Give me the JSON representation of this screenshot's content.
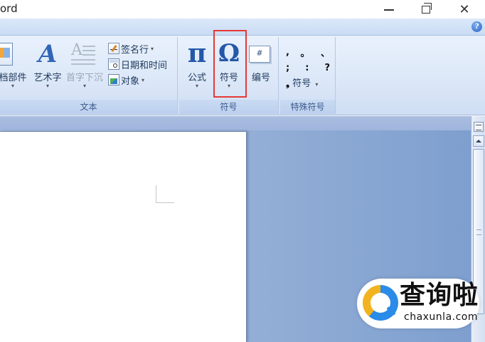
{
  "window": {
    "title": "ord",
    "minimize": "minimize",
    "maximize": "restore",
    "close": "close"
  },
  "ribbon": {
    "groups": {
      "text": {
        "label": "文本",
        "big_buttons": [
          {
            "label": "档部件",
            "icon": "quick-parts-icon"
          },
          {
            "label": "艺术字",
            "icon": "wordart-icon"
          },
          {
            "label": "首字下沉",
            "icon": "drop-cap-icon",
            "disabled": true
          }
        ],
        "small_buttons": [
          {
            "label": "签名行",
            "icon": "signature-line-icon",
            "has_dropdown": true
          },
          {
            "label": "日期和时间",
            "icon": "date-time-icon",
            "has_dropdown": false
          },
          {
            "label": "对象",
            "icon": "object-icon",
            "has_dropdown": true
          }
        ]
      },
      "symbols": {
        "label": "符号",
        "buttons": [
          {
            "label": "公式",
            "icon": "pi-icon",
            "glyph": "π"
          },
          {
            "label": "符号",
            "icon": "omega-icon",
            "glyph": "Ω"
          },
          {
            "label": "编号",
            "icon": "number-icon",
            "glyph": "#"
          }
        ]
      },
      "special": {
        "label": "特殊符号",
        "grid": [
          [
            ",",
            "。",
            "、"
          ],
          [
            ";",
            ":",
            "?"
          ]
        ],
        "symbol_button": "符号",
        "symbol_glyph": "❟"
      }
    }
  },
  "watermark": {
    "cn": "查询啦",
    "en": "chaxunla.com"
  },
  "colors": {
    "highlight_box": "#e53935",
    "ribbon_text": "#1e395b",
    "group_label": "#3b5a8c"
  }
}
